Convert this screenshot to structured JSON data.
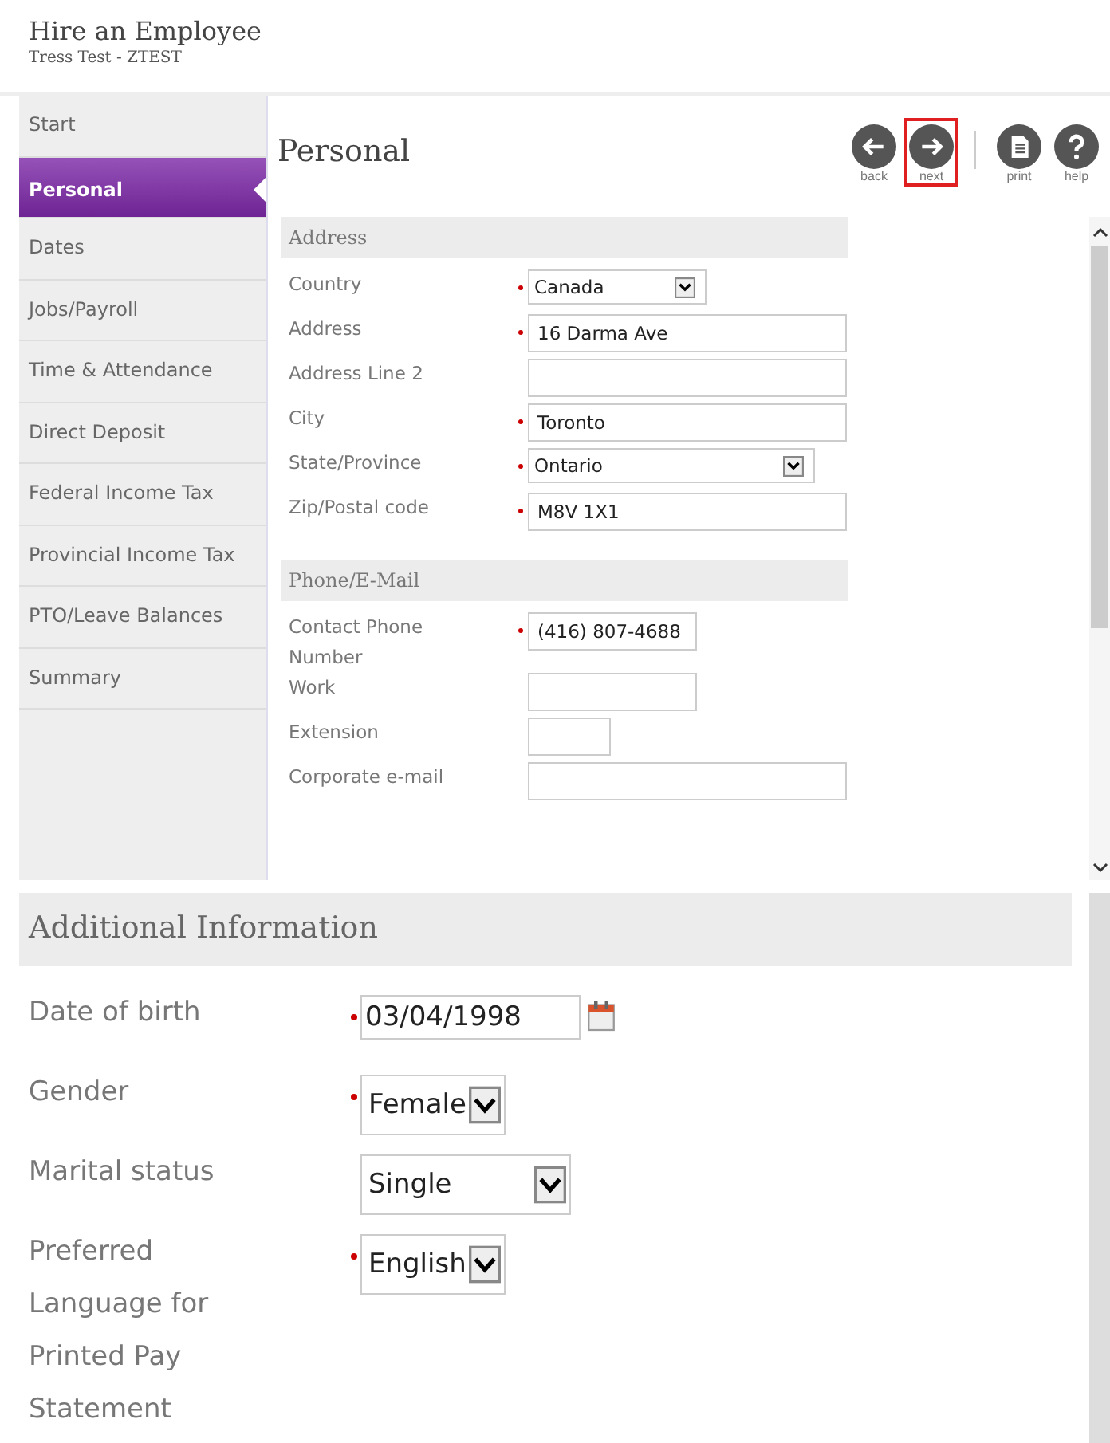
{
  "header": {
    "title": "Hire an Employee",
    "subtitle": "Tress Test - ZTEST"
  },
  "sidebar": {
    "items": [
      {
        "label": "Start",
        "selected": false
      },
      {
        "label": "Personal",
        "selected": true
      },
      {
        "label": "Dates",
        "selected": false
      },
      {
        "label": "Jobs/Payroll",
        "selected": false
      },
      {
        "label": "Time & Attendance",
        "selected": false
      },
      {
        "label": "Direct Deposit",
        "selected": false
      },
      {
        "label": "Federal Income Tax",
        "selected": false
      },
      {
        "label": "Provincial Income Tax",
        "selected": false
      },
      {
        "label": "PTO/Leave Balances",
        "selected": false
      },
      {
        "label": "Summary",
        "selected": false
      }
    ]
  },
  "page_title": "Personal",
  "toolbar": [
    {
      "kind": "back",
      "label": "back",
      "highlighted": false
    },
    {
      "kind": "next",
      "label": "next",
      "highlighted": true
    },
    {
      "kind": "print",
      "label": "print",
      "highlighted": false
    },
    {
      "kind": "help",
      "label": "help",
      "highlighted": false
    }
  ],
  "sections": [
    {
      "title": "Address",
      "fields": [
        {
          "label": "Country",
          "kind": "select",
          "required": true,
          "value": "Canada"
        },
        {
          "label": "Address",
          "kind": "text",
          "required": true,
          "value": "16 Darma Ave"
        },
        {
          "label": "Address Line 2",
          "kind": "text",
          "required": false
        },
        {
          "label": "City",
          "kind": "text",
          "required": true,
          "value": "Toronto"
        },
        {
          "label": "State/Province",
          "kind": "select",
          "required": true,
          "value": "Ontario"
        },
        {
          "label": "Zip/Postal code",
          "kind": "text",
          "required": true,
          "value": "M8V 1X1"
        }
      ]
    },
    {
      "title": "Phone/E-Mail",
      "fields": [
        {
          "label": "Contact Phone Number",
          "kind": "text",
          "required": true,
          "value": "(416) 807-4688"
        },
        {
          "label": "Work",
          "kind": "text",
          "required": false
        },
        {
          "label": "Extension",
          "kind": "text",
          "required": false
        },
        {
          "label": "Corporate e-mail",
          "kind": "text",
          "required": false
        }
      ]
    }
  ],
  "additional": {
    "title": "Additional Information",
    "fields": [
      {
        "label": "Date of birth",
        "kind": "date",
        "required": true,
        "value": "03/04/1998"
      },
      {
        "label": "Gender",
        "kind": "select",
        "required": true,
        "value": "Female"
      },
      {
        "label": "Marital status",
        "kind": "select",
        "required": false,
        "value": "Single"
      },
      {
        "label": "Preferred Language for Printed Pay Statement",
        "kind": "select",
        "required": true,
        "value": "English"
      }
    ]
  }
}
